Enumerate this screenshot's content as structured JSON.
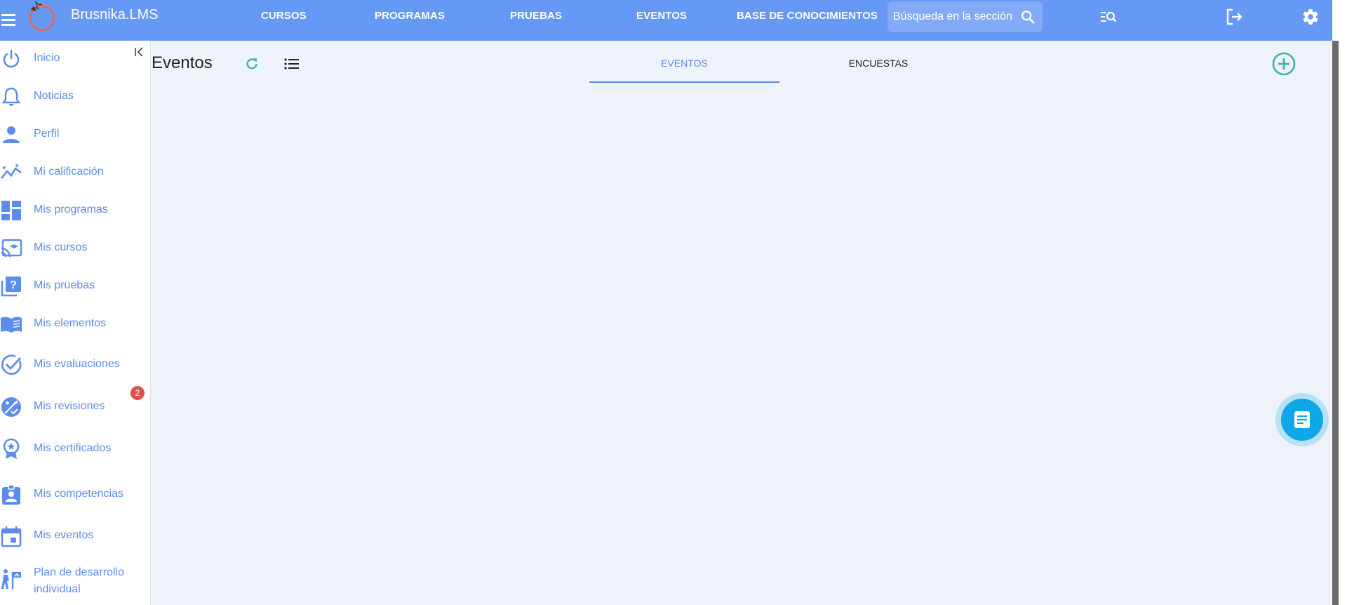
{
  "header": {
    "brand": "Brusnika.LMS",
    "nav": [
      "CURSOS",
      "PROGRAMAS",
      "PRUEBAS",
      "EVENTOS",
      "BASE DE CONOCIMIENTOS"
    ],
    "search_placeholder": "Búsqueda en la sección"
  },
  "sidebar": {
    "items": [
      {
        "label": "Inicio",
        "icon": "power-icon"
      },
      {
        "label": "Noticias",
        "icon": "bell-icon"
      },
      {
        "label": "Perfil",
        "icon": "person-icon"
      },
      {
        "label": "Mi calificación",
        "icon": "chart-icon"
      },
      {
        "label": "Mis programas",
        "icon": "dashboard-icon"
      },
      {
        "label": "Mis cursos",
        "icon": "courses-icon"
      },
      {
        "label": "Mis pruebas",
        "icon": "quiz-icon"
      },
      {
        "label": "Mis elementos",
        "icon": "book-icon"
      },
      {
        "label": "Mis evaluaciones",
        "icon": "check-circle-icon"
      },
      {
        "label": "Mis revisiones",
        "icon": "review-icon"
      },
      {
        "label": "Mis certificados",
        "icon": "award-icon"
      },
      {
        "label": "Mis competencias",
        "icon": "badge-icon"
      },
      {
        "label": "Mis eventos",
        "icon": "calendar-icon"
      },
      {
        "label_line1": "Plan de desarrollo",
        "label_line2": "individual",
        "icon": "development-icon"
      }
    ],
    "revisions_badge": "2"
  },
  "main": {
    "title": "Eventos",
    "tabs": [
      "EVENTOS",
      "ENCUESTAS"
    ]
  },
  "colors": {
    "header": "#6698f5",
    "accent": "#5b8cee",
    "teal": "#3bb6a8",
    "fab": "#0ea8e6",
    "badge": "#e0524a"
  }
}
